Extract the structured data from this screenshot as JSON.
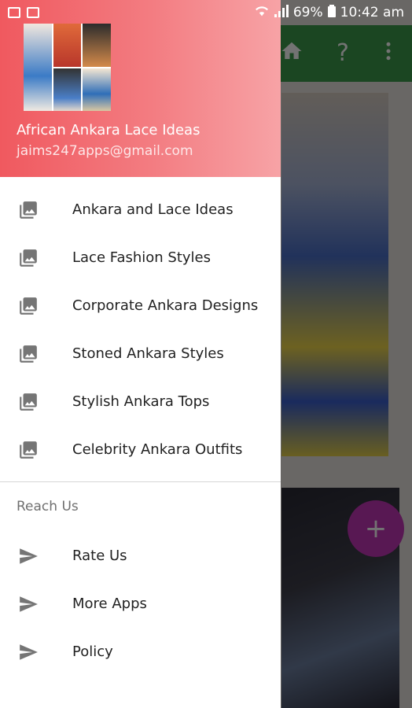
{
  "status_bar": {
    "battery": "69%",
    "time": "10:42 am"
  },
  "app_bar": {
    "home_icon": "home-icon",
    "help_label": "?",
    "overflow_icon": "more-vert-icon"
  },
  "fab": {
    "label": "+"
  },
  "drawer": {
    "header": {
      "app_name": "African Ankara Lace Ideas",
      "email": "jaims247apps@gmail.com",
      "colors": {
        "start": "#f0595f",
        "end": "#f7a3a6"
      }
    },
    "items": [
      {
        "label": "Ankara and Lace Ideas",
        "icon": "photo-library-icon"
      },
      {
        "label": "Lace Fashion Styles",
        "icon": "photo-library-icon"
      },
      {
        "label": "Corporate Ankara Designs",
        "icon": "photo-library-icon"
      },
      {
        "label": "Stoned Ankara Styles",
        "icon": "photo-library-icon"
      },
      {
        "label": "Stylish Ankara Tops",
        "icon": "photo-library-icon"
      },
      {
        "label": "Celebrity Ankara Outfits",
        "icon": "photo-library-icon"
      }
    ],
    "section_title": "Reach Us",
    "reach_items": [
      {
        "label": "Rate Us",
        "icon": "send-icon"
      },
      {
        "label": "More Apps",
        "icon": "send-icon"
      },
      {
        "label": "Policy",
        "icon": "send-icon"
      }
    ]
  }
}
